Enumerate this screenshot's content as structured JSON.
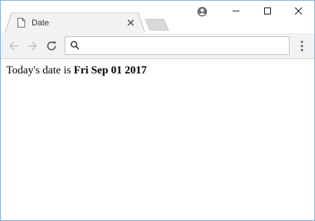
{
  "tab": {
    "title": "Date",
    "page_icon": "page-icon",
    "close_icon": "close-icon"
  },
  "toolbar": {
    "back_icon": "arrow-left-icon",
    "forward_icon": "arrow-right-icon",
    "reload_icon": "reload-icon",
    "search_icon": "search-icon",
    "address_value": "",
    "menu_icon": "vertical-dots-icon"
  },
  "window_controls": [
    "profile-icon",
    "minimize-icon",
    "maximize-icon",
    "close-icon"
  ],
  "page": {
    "prefix": "Today's date is ",
    "date": "Fri Sep 01 2017"
  },
  "colors": {
    "window_border": "#7ea6cf",
    "toolbar_bg": "#f2f2f2",
    "tab_bg": "#f2f2f2"
  }
}
